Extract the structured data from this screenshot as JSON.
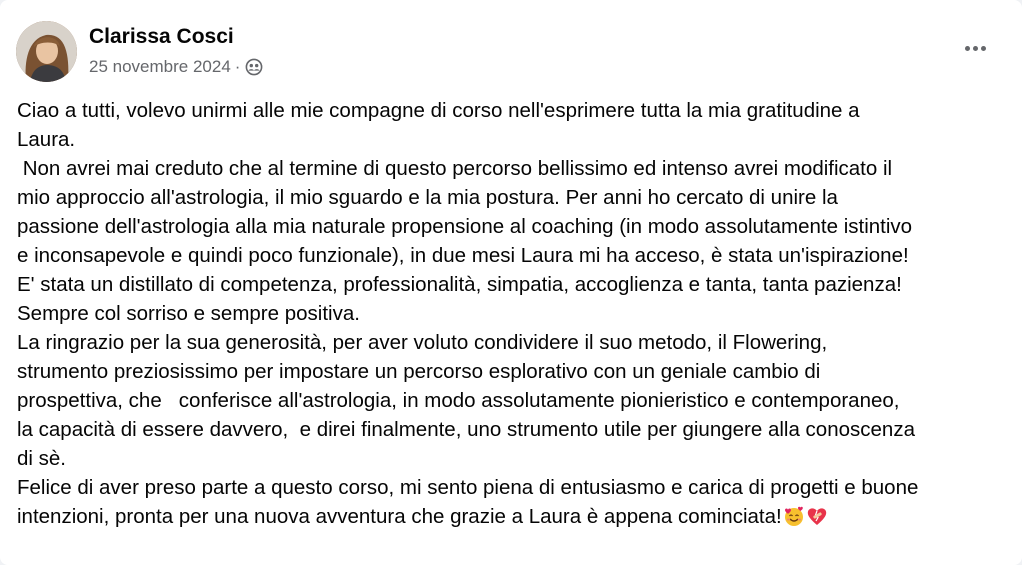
{
  "post": {
    "author": "Clarissa Cosci",
    "date": "25 novembre 2024",
    "separator": "·",
    "audience_icon": "friends-icon",
    "more_icon": "more-options-icon",
    "body_lines": [
      "Ciao a tutti, volevo unirmi alle mie compagne di corso nell'esprimere tutta la mia gratitudine a",
      "Laura.",
      " Non avrei mai creduto che al termine di questo percorso bellissimo ed intenso avrei modificato il",
      "mio approccio all'astrologia, il mio sguardo e la mia postura. Per anni ho cercato di unire la",
      "passione dell'astrologia alla mia naturale propensione al coaching (in modo assolutamente istintivo",
      "e inconsapevole e quindi poco funzionale), in due mesi Laura mi ha acceso, è stata un'ispirazione!",
      "E' stata un distillato di competenza, professionalità, simpatia, accoglienza e tanta, tanta pazienza!",
      "Sempre col sorriso e sempre positiva.",
      "La ringrazio per la sua generosità, per aver voluto condividere il suo metodo, il Flowering,",
      "strumento preziosissimo per impostare un percorso esplorativo con un geniale cambio di",
      "prospettiva, che   conferisce all'astrologia, in modo assolutamente pionieristico e contemporaneo,",
      "la capacità di essere davvero,  e direi finalmente, uno strumento utile per giungere alla conoscenza",
      "di sè.",
      "Felice di aver preso parte a questo corso, mi sento piena di entusiasmo e carica di progetti e buone",
      "intenzioni, pronta per una nuova avventura che grazie a Laura è appena cominciata!"
    ],
    "trailing_emojis": [
      "smiling-face-with-hearts-emoji",
      "mending-heart-emoji"
    ]
  }
}
